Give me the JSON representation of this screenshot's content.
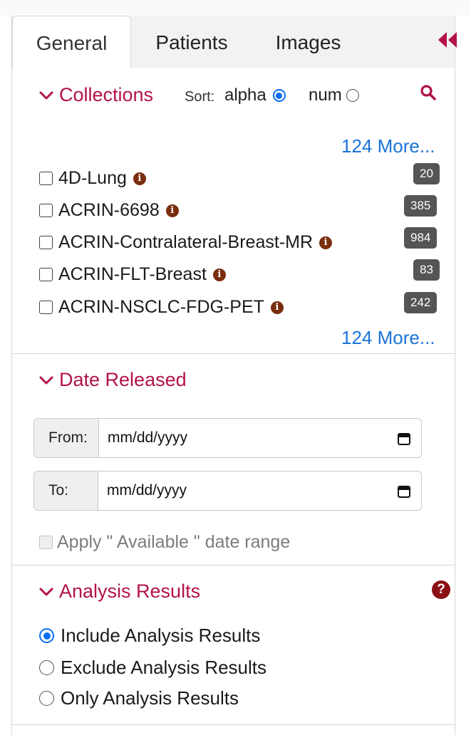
{
  "tabs": [
    {
      "label": "General",
      "active": true
    },
    {
      "label": "Patients",
      "active": false
    },
    {
      "label": "Images",
      "active": false
    }
  ],
  "collections": {
    "title": "Collections",
    "sort_label": "Sort:",
    "sort_options": [
      {
        "label": "alpha",
        "selected": true
      },
      {
        "label": "num",
        "selected": false
      }
    ],
    "more_top": "124 More...",
    "more_bottom": "124 More...",
    "items": [
      {
        "name": "4D-Lung",
        "count": "20"
      },
      {
        "name": "ACRIN-6698",
        "count": "385"
      },
      {
        "name": "ACRIN-Contralateral-Breast-MR",
        "count": "984"
      },
      {
        "name": "ACRIN-FLT-Breast",
        "count": "83"
      },
      {
        "name": "ACRIN-NSCLC-FDG-PET",
        "count": "242"
      }
    ]
  },
  "date_released": {
    "title": "Date Released",
    "from_label": "From:",
    "from_placeholder": "mm/dd/yyyy",
    "to_label": "To:",
    "to_placeholder": "mm/dd/yyyy",
    "apply_label": "Apply \" Available \" date range"
  },
  "analysis_results": {
    "title": "Analysis Results",
    "options": [
      {
        "label": "Include Analysis Results",
        "selected": true
      },
      {
        "label": "Exclude Analysis Results",
        "selected": false
      },
      {
        "label": "Only Analysis Results",
        "selected": false
      }
    ]
  },
  "colors": {
    "accent": "#b3124a",
    "link": "#1a73d9",
    "badge": "#555555",
    "info_icon": "#7a2e0e",
    "help_icon": "#8b0f14",
    "radio": "#0a6cf5"
  }
}
